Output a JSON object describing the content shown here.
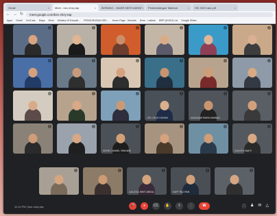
{
  "browser": {
    "tabs": [
      {
        "label": "Gmail",
        "active": false
      },
      {
        "label": "Meet - bsn-xhzy-tap",
        "active": true
      },
      {
        "label": "BORANG - HADIR MESYUARAT",
        "active": false
      },
      {
        "label": "Pembentangan Taklimat",
        "active": false
      },
      {
        "label": "ISK 2023 dan pdf",
        "active": false
      }
    ],
    "address": "meet.google.com/bsn-xhzy-tap",
    "bookmarks": [
      "Apps",
      "Gmail",
      "YouTube",
      "Maps",
      "Drive",
      "Ministry Of Educati...",
      "PENGURUSAN SEK...",
      "Home Page - Sekolah",
      "Drive - Latihan",
      "BRP (KOKO) Ltd",
      "Google Slides"
    ]
  },
  "participants_rows": [
    [
      {
        "name": "",
        "bg": "#5b6d86",
        "skin": "#d9a47f",
        "cloth": "#2a2a2a"
      },
      {
        "name": "",
        "bg": "#b9b1a6",
        "skin": "#e0b592",
        "cloth": "#1a1a1a"
      },
      {
        "name": "",
        "bg": "#d25d2c",
        "skin": "#c98f6a",
        "cloth": "#6b3d2e"
      },
      {
        "name": "",
        "bg": "#c4b6a6",
        "skin": "#d9ab88",
        "cloth": "#5a5a6a"
      },
      {
        "name": "",
        "bg": "#3b9bc8",
        "skin": "#e0b596",
        "cloth": "#8f3f55"
      },
      {
        "name": "",
        "bg": "#c9a98a",
        "skin": "#dbb092",
        "cloth": "#3d3d3d"
      }
    ],
    [
      {
        "name": "",
        "bg": "#4a6fa7",
        "skin": "#d6a07c",
        "cloth": "#233b67"
      },
      {
        "name": "",
        "bg": "#6a7a88",
        "skin": "#c69a7a",
        "cloth": "#2f2f2f"
      },
      {
        "name": "",
        "bg": "#d9c7b3",
        "skin": "#d4a27f",
        "cloth": "#2e2e2e"
      },
      {
        "name": "",
        "bg": "#3a6f8a",
        "skin": "#c8946e",
        "cloth": "#1f2f3f"
      },
      {
        "name": "",
        "bg": "#b8a48e",
        "skin": "#cf9d77",
        "cloth": "#7a2a2a"
      },
      {
        "name": "",
        "bg": "#8f9aa8",
        "skin": "#d8a983",
        "cloth": "#343a44"
      }
    ],
    [
      {
        "name": "",
        "bg": "#d4ccc0",
        "skin": "#d8ab88",
        "cloth": "#5d4a4a"
      },
      {
        "name": "",
        "bg": "#b7a38d",
        "skin": "#d9a886",
        "cloth": "#2a3a2a"
      },
      {
        "name": "",
        "bg": "#7ea0b8",
        "skin": "#c99a76",
        "cloth": "#2e2e3e"
      },
      {
        "name": "LEE CHUO HOONG",
        "bg": "#4a5058",
        "skin": "#d9b08c",
        "cloth": "#1e2c48"
      },
      {
        "name": "NAGASAM PAIRA KANNAN",
        "bg": "#50555c",
        "skin": "#c9956f",
        "cloth": "#222"
      },
      {
        "name": "",
        "bg": "#5a5f66",
        "skin": "#d1a17c",
        "cloth": "#3a3a3a"
      }
    ],
    [
      {
        "name": "",
        "bg": "#8a8276",
        "skin": "#cf9c76",
        "cloth": "#2b2b2b"
      },
      {
        "name": "",
        "bg": "#9aa3ad",
        "skin": "#d8a783",
        "cloth": "#1f1f1f"
      },
      {
        "name": "MOHD CHANEL ONN ABD",
        "bg": "#4c5157",
        "skin": "#d2a079",
        "cloth": "#1d1d1d"
      },
      {
        "name": "",
        "bg": "#a79480",
        "skin": "#d6a27e",
        "cloth": "#4a3a2a"
      },
      {
        "name": "",
        "bg": "#6f8fa3",
        "skin": "#cf9e78",
        "cloth": "#2a3a4a"
      },
      {
        "name": "ZULKIFLI BAKTI",
        "bg": "#54595f",
        "skin": "#d8a984",
        "cloth": "#2a2a2a"
      }
    ]
  ],
  "participants_row5": [
    {
      "name": "",
      "bg": "#a9a095",
      "skin": "#d6a681",
      "cloth": "#7a6a5a"
    },
    {
      "name": "",
      "bg": "#8c7b66",
      "skin": "#cc9a74",
      "cloth": "#3a3030"
    },
    {
      "name": "LAILATUL BINTI ABDUL",
      "bg": "#4e5359",
      "skin": "#d4a47f",
      "cloth": "#3a2a3a"
    },
    {
      "name": "KAPT RAJ RAN",
      "bg": "#4a4f55",
      "skin": "#d0a07a",
      "cloth": "#1f2a3a"
    },
    {
      "name": "",
      "bg": "#5c6168",
      "skin": "#d6a683",
      "cloth": "#2f2f2f"
    }
  ],
  "meeting": {
    "time": "11:11 PM",
    "code": "bsn-xhzy-tap"
  },
  "controls": [
    "mic",
    "camera",
    "captions",
    "present",
    "raise-hand",
    "more"
  ],
  "colors": {
    "accent_red": "#ea4335",
    "bar_bg": "#202124"
  }
}
